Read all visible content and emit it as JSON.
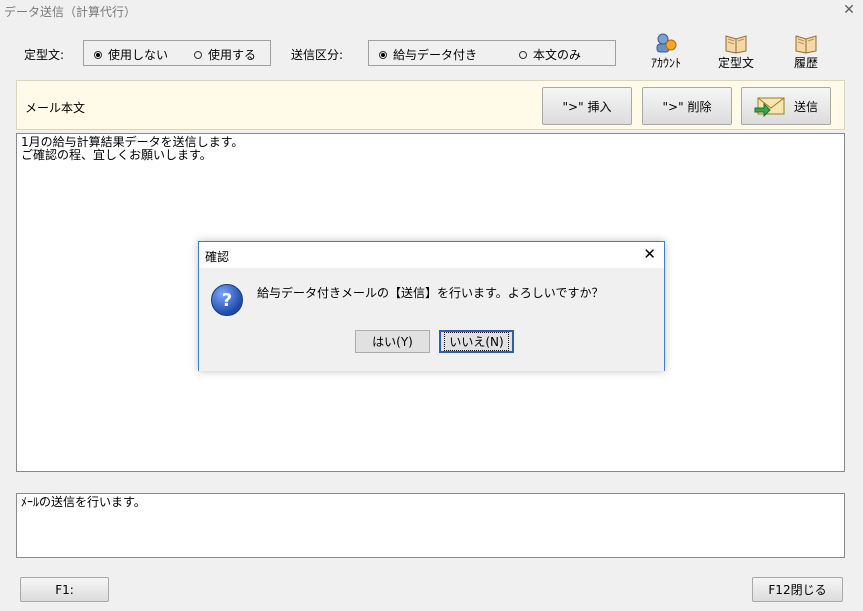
{
  "window": {
    "title": "データ送信（計算代行）"
  },
  "options": {
    "template_label": "定型文:",
    "template_choices": [
      {
        "label": "使用しない",
        "selected": true
      },
      {
        "label": "使用する",
        "selected": false
      }
    ],
    "send_type_label": "送信区分:",
    "send_type_choices": [
      {
        "label": "給与データ付き",
        "selected": true
      },
      {
        "label": "本文のみ",
        "selected": false
      }
    ]
  },
  "toolbar": {
    "account_label": "ｱｶｳﾝﾄ",
    "template_label": "定型文",
    "history_label": "履歴"
  },
  "mail": {
    "header_label": "メール本文",
    "insert_button": "\"&gt;\" 挿入",
    "delete_button": "\"&gt;\" 削除",
    "send_button": "送信",
    "body_lines": [
      "1月の給与計算結果データを送信します。",
      "ご確認の程、宜しくお願いします。"
    ]
  },
  "status": {
    "message": "ﾒｰﾙの送信を行います。"
  },
  "footer": {
    "f1_label": "F1:",
    "f12_label": "F12閉じる"
  },
  "dialog": {
    "title": "確認",
    "message": "給与データ付きメールの【送信】を行います。よろしいですか？",
    "yes_label": "はい(Y)",
    "no_label": "いいえ(N)"
  },
  "colors": {
    "header_bg": "#fffbe8",
    "dialog_border": "#3b7fd1",
    "question_icon": "#1f4ba8"
  }
}
